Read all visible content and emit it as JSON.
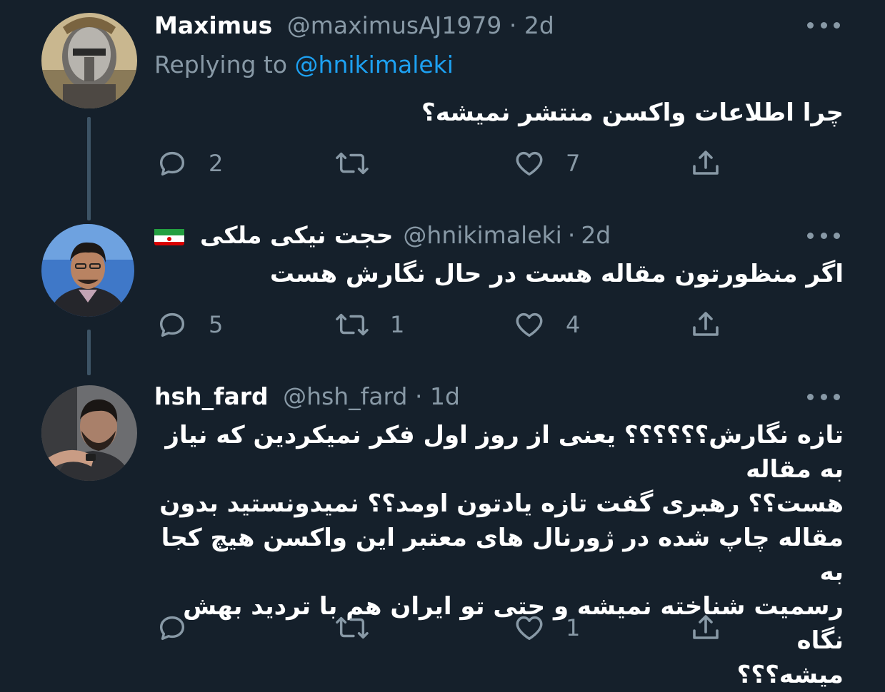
{
  "tweets": [
    {
      "name": "Maximus",
      "handle": "@maximusAJ1979",
      "separator": "·",
      "time": "2d",
      "replying_prefix": "Replying to",
      "replying_mention": "@hnikimaleki",
      "text": "چرا اطلاعات واکسن منتشر نمیشه؟",
      "reply_count": "2",
      "retweet_count": "",
      "like_count": "7"
    },
    {
      "name": "حجت نیکی ملکی",
      "handle": "@hnikimaleki",
      "separator": "·",
      "time": "2d",
      "flag_icon": "iran-flag-icon",
      "text": "اگر منظورتون مقاله هست در حال نگارش هست",
      "reply_count": "5",
      "retweet_count": "1",
      "like_count": "4"
    },
    {
      "name": "hsh_fard",
      "handle": "@hsh_fard",
      "separator": "·",
      "time": "1d",
      "text_lines": [
        "تازه نگارش؟؟؟؟؟؟ یعنی از روز اول فکر نمیکردین که نیاز به مقاله",
        "هست؟؟ رهبری گفت تازه یادتون اومد؟؟ نمیدونستید بدون",
        "مقاله چاپ شده در ژورنال های معتبر این واکسن هیچ کجا به",
        "رسمیت شناخته نمیشه و حتی تو ایران هم با تردید بهش نگاه",
        "میشه؟؟؟"
      ],
      "reply_count": "",
      "retweet_count": "",
      "like_count": "1"
    }
  ],
  "colors": {
    "background": "#15202b",
    "secondary_text": "#8899a6",
    "link": "#1da1f2",
    "thread_line": "#3d5466"
  },
  "icons": [
    "reply-icon",
    "retweet-icon",
    "like-icon",
    "share-icon",
    "more-options-icon"
  ]
}
